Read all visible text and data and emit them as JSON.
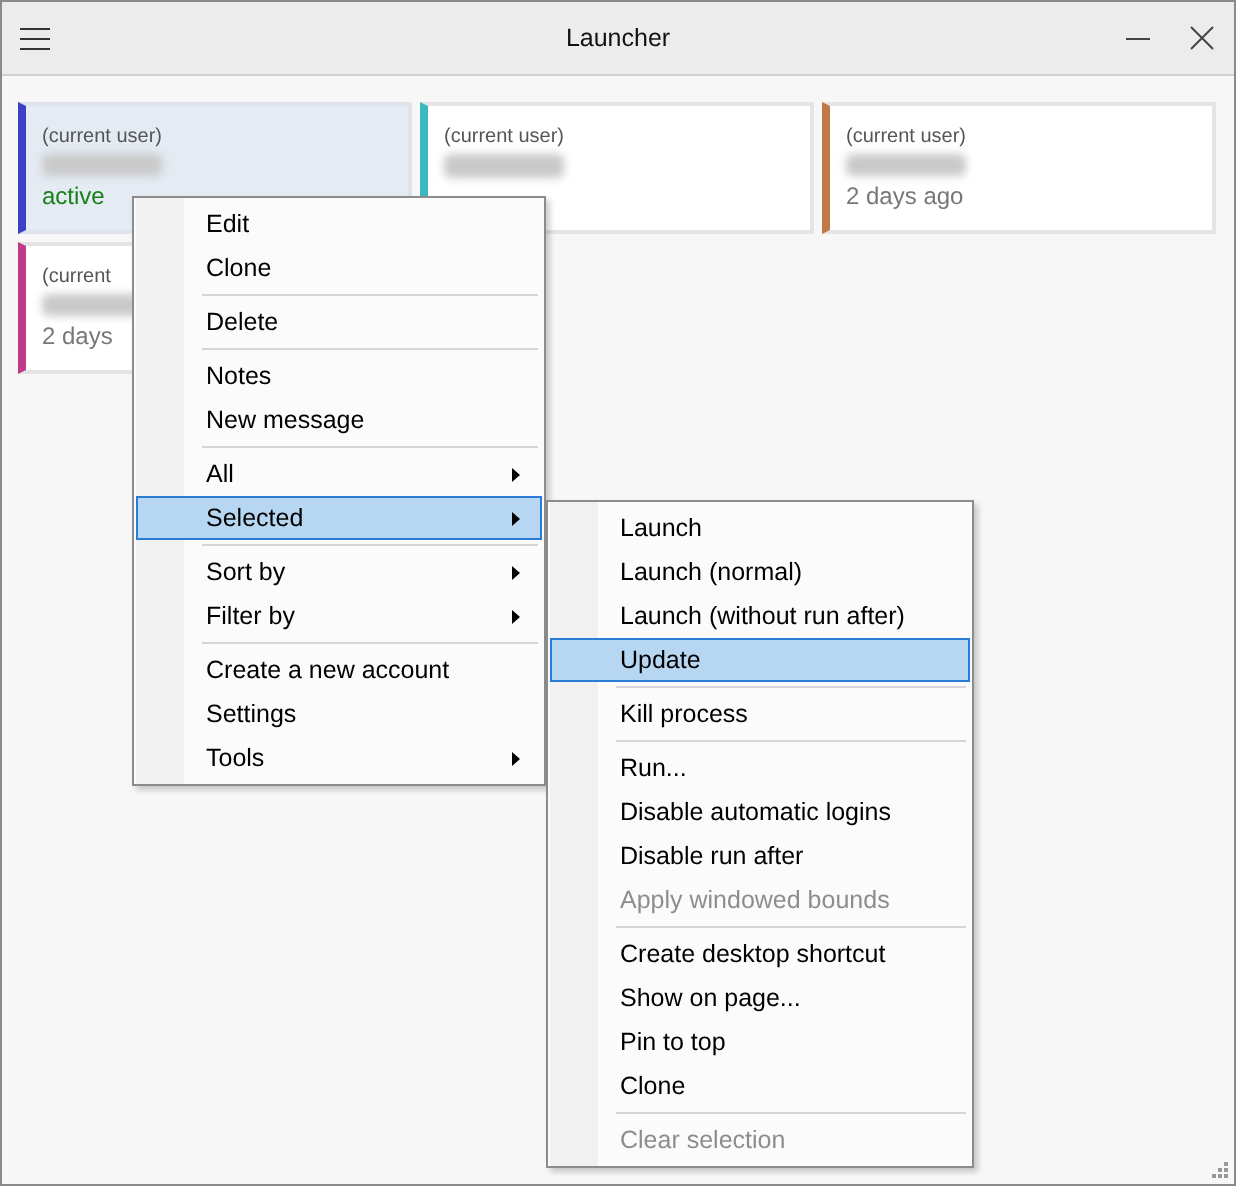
{
  "window": {
    "title": "Launcher"
  },
  "cards": [
    {
      "caption": "(current user)",
      "status": "active",
      "status_active": true,
      "color": "#3f3fc4",
      "selected": true
    },
    {
      "caption": "(current user)",
      "color": "#3cb8c0",
      "selected": false
    },
    {
      "caption": "(current user)",
      "status": "2 days ago",
      "status_active": false,
      "color": "#c07a48",
      "selected": false
    },
    {
      "caption": "(current",
      "status": "2 days",
      "status_active": false,
      "color": "#c03c86",
      "selected": false
    }
  ],
  "context_menu": {
    "items": [
      {
        "kind": "item",
        "label": "Edit",
        "selected": false,
        "disabled": false,
        "submenu": false
      },
      {
        "kind": "item",
        "label": "Clone",
        "selected": false,
        "disabled": false,
        "submenu": false
      },
      {
        "kind": "separator"
      },
      {
        "kind": "item",
        "label": "Delete",
        "selected": false,
        "disabled": false,
        "submenu": false
      },
      {
        "kind": "separator"
      },
      {
        "kind": "item",
        "label": "Notes",
        "selected": false,
        "disabled": false,
        "submenu": false
      },
      {
        "kind": "item",
        "label": "New message",
        "selected": false,
        "disabled": false,
        "submenu": false
      },
      {
        "kind": "separator"
      },
      {
        "kind": "item",
        "label": "All",
        "selected": false,
        "disabled": false,
        "submenu": true
      },
      {
        "kind": "item",
        "label": "Selected",
        "selected": true,
        "disabled": false,
        "submenu": true
      },
      {
        "kind": "separator"
      },
      {
        "kind": "item",
        "label": "Sort by",
        "selected": false,
        "disabled": false,
        "submenu": true
      },
      {
        "kind": "item",
        "label": "Filter by",
        "selected": false,
        "disabled": false,
        "submenu": true
      },
      {
        "kind": "separator"
      },
      {
        "kind": "item",
        "label": "Create a new account",
        "selected": false,
        "disabled": false,
        "submenu": false
      },
      {
        "kind": "item",
        "label": "Settings",
        "selected": false,
        "disabled": false,
        "submenu": false
      },
      {
        "kind": "item",
        "label": "Tools",
        "selected": false,
        "disabled": false,
        "submenu": true
      }
    ]
  },
  "submenu": {
    "items": [
      {
        "kind": "item",
        "label": "Launch",
        "selected": false,
        "disabled": false,
        "submenu": false
      },
      {
        "kind": "item",
        "label": "Launch (normal)",
        "selected": false,
        "disabled": false,
        "submenu": false
      },
      {
        "kind": "item",
        "label": "Launch (without run after)",
        "selected": false,
        "disabled": false,
        "submenu": false
      },
      {
        "kind": "item",
        "label": "Update",
        "selected": true,
        "disabled": false,
        "submenu": false
      },
      {
        "kind": "separator"
      },
      {
        "kind": "item",
        "label": "Kill process",
        "selected": false,
        "disabled": false,
        "submenu": false
      },
      {
        "kind": "separator"
      },
      {
        "kind": "item",
        "label": "Run...",
        "selected": false,
        "disabled": false,
        "submenu": false
      },
      {
        "kind": "item",
        "label": "Disable automatic logins",
        "selected": false,
        "disabled": false,
        "submenu": false
      },
      {
        "kind": "item",
        "label": "Disable run after",
        "selected": false,
        "disabled": false,
        "submenu": false
      },
      {
        "kind": "item",
        "label": "Apply windowed bounds",
        "selected": false,
        "disabled": true,
        "submenu": false
      },
      {
        "kind": "separator"
      },
      {
        "kind": "item",
        "label": "Create desktop shortcut",
        "selected": false,
        "disabled": false,
        "submenu": false
      },
      {
        "kind": "item",
        "label": "Show on page...",
        "selected": false,
        "disabled": false,
        "submenu": false
      },
      {
        "kind": "item",
        "label": "Pin to top",
        "selected": false,
        "disabled": false,
        "submenu": false
      },
      {
        "kind": "item",
        "label": "Clone",
        "selected": false,
        "disabled": false,
        "submenu": false
      },
      {
        "kind": "separator"
      },
      {
        "kind": "item",
        "label": "Clear selection",
        "selected": false,
        "disabled": true,
        "submenu": false
      }
    ]
  }
}
